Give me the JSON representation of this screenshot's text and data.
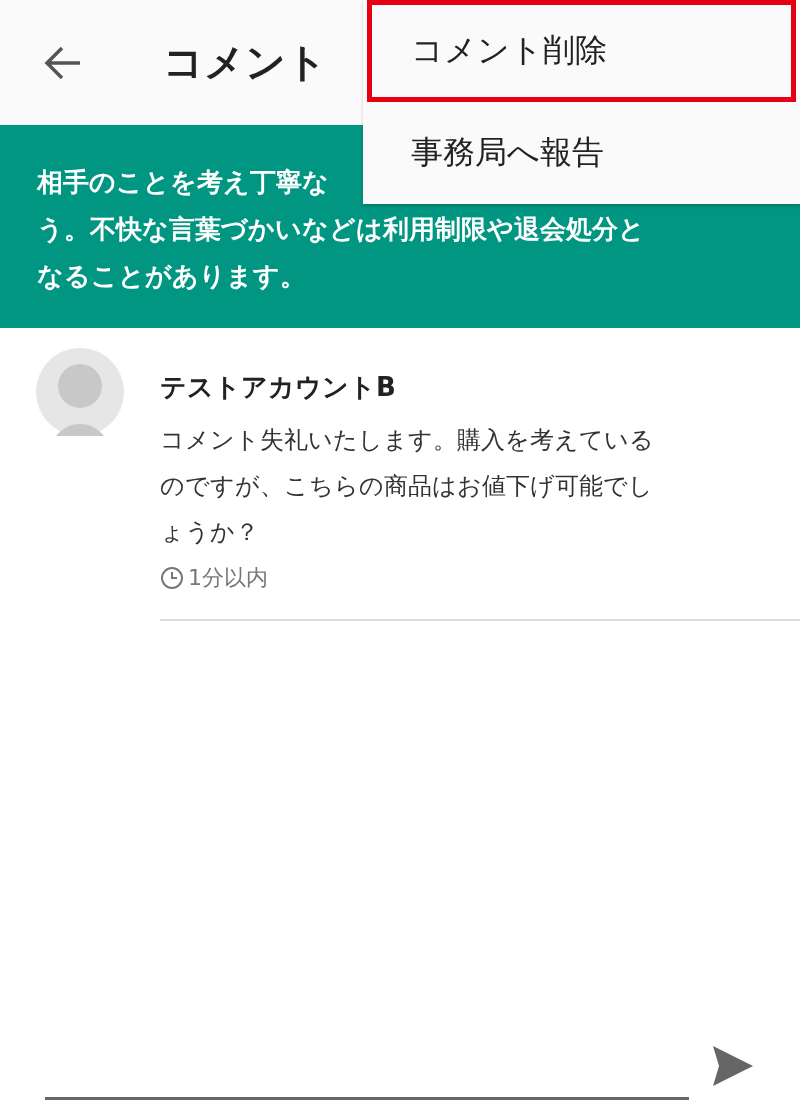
{
  "header": {
    "title": "コメント"
  },
  "menu": {
    "items": [
      {
        "label": "コメント削除",
        "highlighted": true
      },
      {
        "label": "事務局へ報告",
        "highlighted": false
      }
    ]
  },
  "notice": {
    "lines": [
      "相手のことを考え丁寧な",
      "う。不快な言葉づかいなどは利用制限や退会処分と",
      "なることがあります。"
    ]
  },
  "comments": [
    {
      "author": "テストアカウントB",
      "text": "コメント失礼いたします。購入を考えているのですが、こちらの商品はお値下げ可能でしょうか？",
      "time": "1分以内"
    }
  ]
}
